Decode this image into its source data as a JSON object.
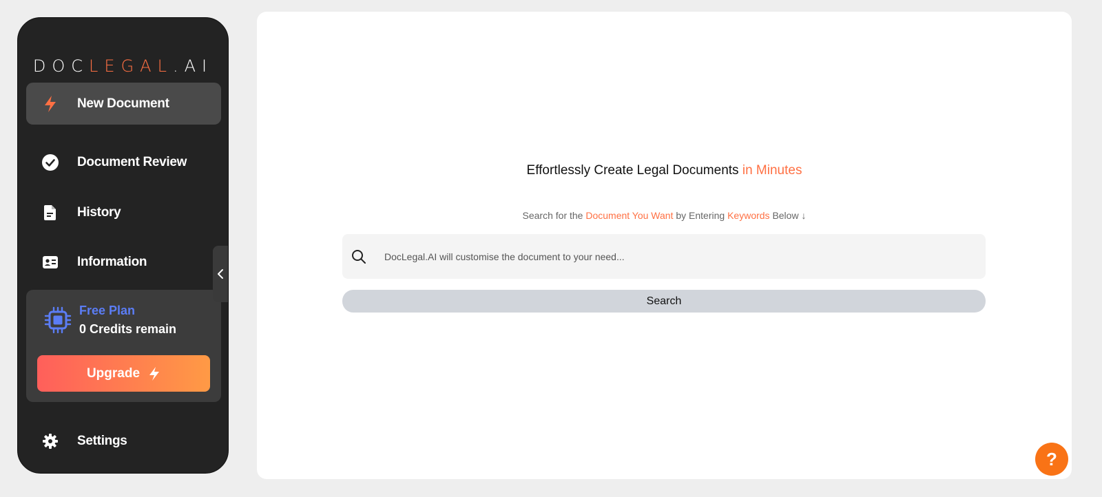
{
  "logo": {
    "part1": "DOC",
    "part2": "LEGAL",
    "part3": ".AI"
  },
  "colors": {
    "accent": "#ff7043",
    "plan_blue": "#5b7df5",
    "sidebar_bg": "#232323",
    "help": "#f97316"
  },
  "sidebar": {
    "items": [
      {
        "label": "New Document",
        "icon": "bolt-icon"
      },
      {
        "label": "Document Review",
        "icon": "check-circle-icon"
      },
      {
        "label": "History",
        "icon": "document-icon"
      },
      {
        "label": "Information",
        "icon": "id-card-icon"
      }
    ],
    "plan": {
      "name": "Free Plan",
      "credits": "0 Credits remain",
      "icon": "chip-icon"
    },
    "upgrade_label": "Upgrade",
    "settings_label": "Settings"
  },
  "main": {
    "headline": "Effortlessly Create Legal Documents",
    "headline_accent": "in Minutes",
    "sub": {
      "p1": "Search for the",
      "a1": "Document You Want",
      "p2": "by Entering",
      "a2": "Keywords",
      "p3": "Below ↓"
    },
    "search": {
      "placeholder": "DocLegal.AI will customise the document to your need..."
    },
    "search_button": "Search"
  },
  "help": {
    "label": "?"
  }
}
